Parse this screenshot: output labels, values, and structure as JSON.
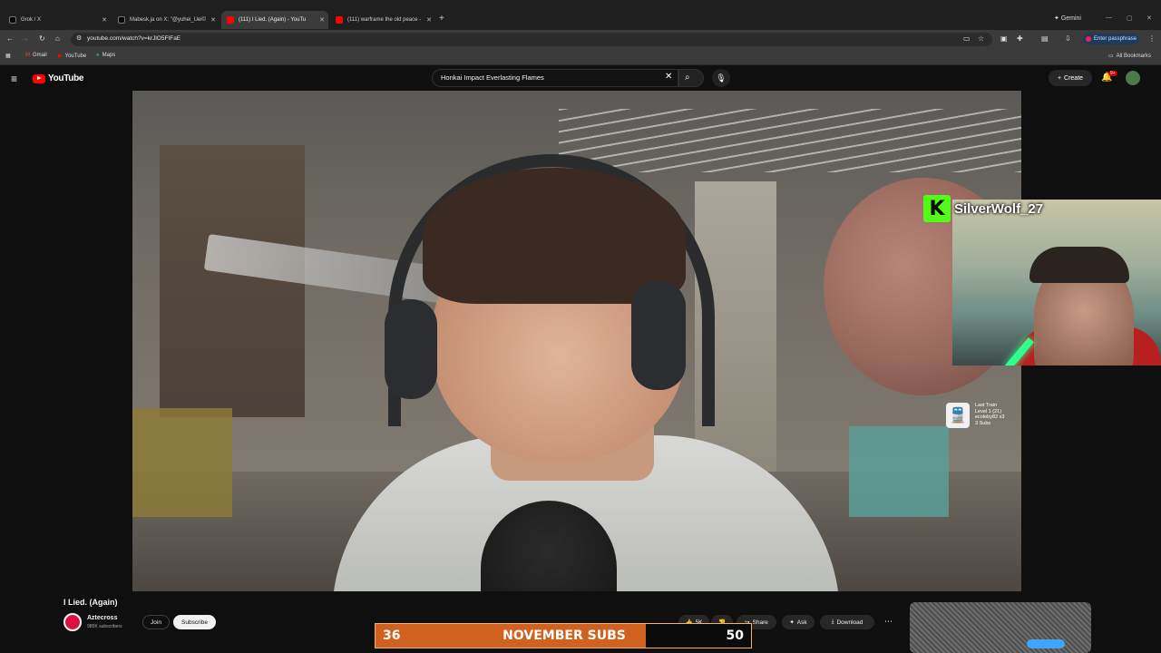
{
  "browser": {
    "tabs": [
      {
        "label": "Grok / X",
        "color": "#000000"
      },
      {
        "label": "Mabesk.ja on X: \"@yuhei_Uei©",
        "color": "#000000"
      },
      {
        "label": "(111) I Lied. (Again) - YouTu",
        "color": "#ff0000"
      },
      {
        "label": "(111) warframe the old peace -",
        "color": "#ff0000"
      }
    ],
    "gemini_label": "Gemini",
    "url": "youtube.com/watch?v=krJlO5FIFaE",
    "passphrase_label": "Enter passphrase",
    "bookmarks": [
      "Gmail",
      "YouTube",
      "Maps"
    ],
    "all_bookmarks": "All Bookmarks"
  },
  "youtube": {
    "logo_text": "YouTube",
    "search_value": "Honkai Impact Everlasting Flames",
    "create_label": "Create",
    "notification_badge": "9+"
  },
  "overlay": {
    "streamer_name": "SilverWolf_27",
    "kick_letter": "K",
    "last_train_lines": [
      "Last Train",
      "Level 1 (21)",
      "ecoleby82 x3",
      "3 Subs"
    ],
    "subs_current": "36",
    "subs_title": "NOVEMBER SUBS",
    "subs_goal": "50",
    "subs_progress": 0.72
  },
  "video": {
    "title": "I Lied. (Again)",
    "channel": "Aztecross",
    "subscribers": "985K subscribers",
    "join_label": "Join",
    "subscribe_label": "Subscribe",
    "like_count": "5K",
    "share_label": "Share",
    "ask_label": "Ask",
    "download_label": "Download"
  }
}
